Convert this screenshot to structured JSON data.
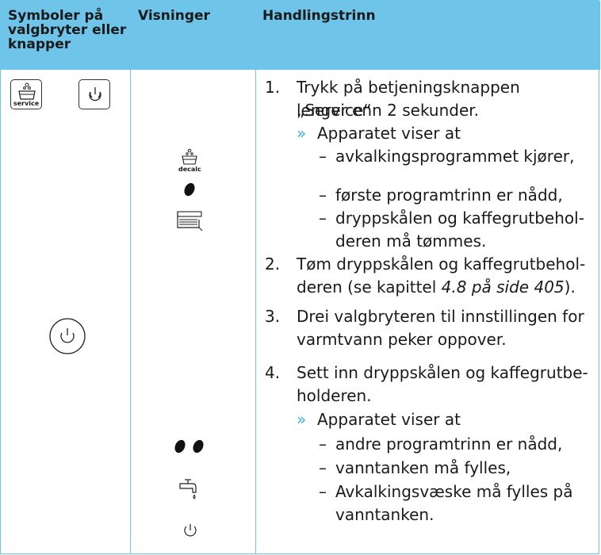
{
  "columns": [
    "Symboler på\nvalgbryter eller\nknapper",
    "Visninger",
    "Handlingstrinn"
  ],
  "col1_header_lines": [
    "Symboler på",
    "valgbryter eller",
    "knapper"
  ],
  "col2_header": "Visninger",
  "col3_header": "Handlingstrinn",
  "left_icons": {
    "service_label": "service",
    "power_button_icon": "power-button-icon"
  },
  "display_icons": {
    "decalc_label": "decalc"
  },
  "steps": {
    "s1_num": "1.",
    "s1_line1": "Trykk på betjeningsknappen „Service“",
    "s1_line2": "lenger enn 2 sekunder.",
    "s1_result": "Apparatet viser at",
    "s1_b1": "avkalkingsprogrammet kjører,",
    "s1_b2": "første programtrinn er nådd,",
    "s1_b3_line1": "dryppskålen og kaffegrutbehol-",
    "s1_b3_line2": "deren må tømmes.",
    "s2_num": "2.",
    "s2_line1": "Tøm dryppskålen og kaffegrutbehol-",
    "s2_line2_a": "deren (se kapittel ",
    "s2_line2_ref": "4.8 på side 405",
    "s2_line2_b": ").",
    "s3_num": "3.",
    "s3_line1": "Drei valgbryteren til innstillingen for",
    "s3_line2": "varmtvann peker oppover.",
    "s4_num": "4.",
    "s4_line1": "Sett inn dryppskålen og kaffegrutbe-",
    "s4_line2": "holderen.",
    "s4_result": "Apparatet viser at",
    "s4_b1": "andre programtrinn er nådd,",
    "s4_b2": "vanntanken må fylles,",
    "s4_b3_line1": "Avkalkingsvæske må fylles på",
    "s4_b3_line2": "vanntanken."
  },
  "symbols": {
    "arrow": "»",
    "dash": "–"
  },
  "colors": {
    "header_bg": "#6fc4ea",
    "accent": "#3bb0e3"
  }
}
